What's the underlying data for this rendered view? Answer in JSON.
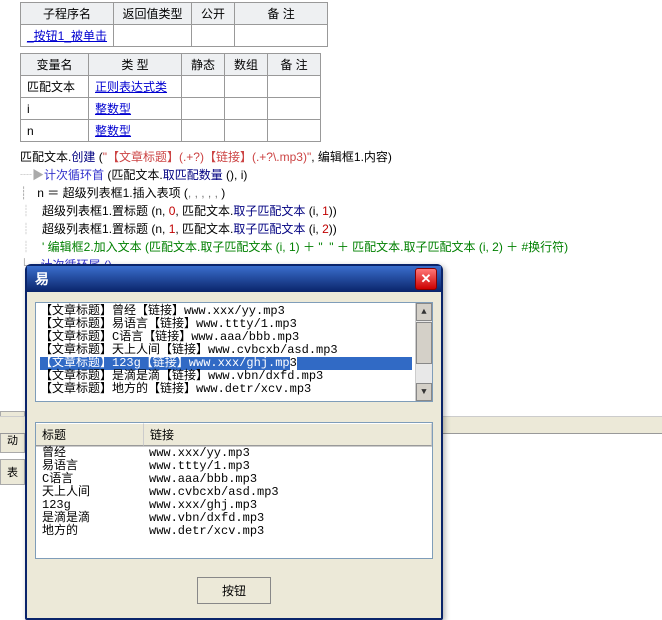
{
  "subProc": {
    "headers": [
      "子程序名",
      "返回值类型",
      "公开",
      "备 注"
    ],
    "row": [
      "_按钮1_被单击",
      "",
      "",
      ""
    ]
  },
  "vars": {
    "headers": [
      "变量名",
      "类 型",
      "静态",
      "数组",
      "备 注"
    ],
    "rows": [
      {
        "name": "匹配文本",
        "type": "正则表达式类"
      },
      {
        "name": "i",
        "type": "整数型"
      },
      {
        "name": "n",
        "type": "整数型"
      }
    ]
  },
  "code": {
    "l1": {
      "a": "匹配文本.",
      "b": "创建 ",
      "c": "(",
      "d": "\"【文章标题】(.+?)【链接】(.+?\\.mp3)\"",
      "e": ", 编辑框1.内容)"
    },
    "l2": {
      "a": "计次循环首 ",
      "b": "(匹配文本.",
      "c": "取匹配数量 ",
      "d": "()",
      "e": ", i)"
    },
    "l3": {
      "a": "n ＝ 超级列表框1.插入表项 ",
      "b": "(",
      " c": ", , , , , ",
      "d": ")"
    },
    "l4": {
      "a": "超级列表框1.置标题 ",
      "b": "(n, ",
      "n0": "0",
      "c": ", 匹配文本.",
      "d": "取子匹配文本 ",
      "e": "(i, ",
      "n1": "1",
      "f": "))"
    },
    "l5": {
      "a": "超级列表框1.置标题 ",
      "b": "(n, ",
      "n0": "1",
      "c": ", 匹配文本.",
      "d": "取子匹配文本 ",
      "e": "(i, ",
      "n1": "2",
      "f": "))"
    },
    "l6": "' 编辑框2.加入文本 (匹配文本.取子匹配文本 (i, 1) ＋ \"  \" ＋ 匹配文本.取子匹配文本 (i, 2) ＋ #换行符)",
    "l7": "计次循环尾 ()"
  },
  "sideTabs": [
    "自动",
    "表"
  ],
  "window": {
    "title": "易",
    "textLines": [
      "【文章标题】曾经【链接】www.xxx/yy.mp3",
      "【文章标题】易语言【链接】www.ttty/1.mp3",
      "【文章标题】C语言【链接】www.aaa/bbb.mp3",
      "【文章标题】天上人间【链接】www.cvbcxb/asd.mp3",
      "【文章标题】123g【链接】www.xxx/ghj.mp3",
      "【文章标题】是滴是滴【链接】www.vbn/dxfd.mp3",
      "【文章标题】地方的【链接】www.detr/xcv.mp3"
    ],
    "listHeaders": [
      "标题",
      "链接"
    ],
    "listRows": [
      [
        "曾经",
        "www.xxx/yy.mp3"
      ],
      [
        "易语言",
        "www.ttty/1.mp3"
      ],
      [
        "C语言",
        "www.aaa/bbb.mp3"
      ],
      [
        "天上人间",
        "www.cvbcxb/asd.mp3"
      ],
      [
        "123g",
        "www.xxx/ghj.mp3"
      ],
      [
        "是滴是滴",
        "www.vbn/dxfd.mp3"
      ],
      [
        "地方的",
        "www.detr/xcv.mp3"
      ]
    ],
    "button": "按钮"
  }
}
